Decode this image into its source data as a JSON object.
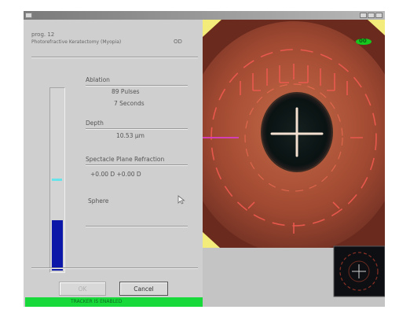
{
  "window": {
    "title": "",
    "status_text": "TRACKER IS ENABLED",
    "green_indicator": "00"
  },
  "dialog": {
    "program_line": "prog. 12",
    "mode_line": "Photorefractive Keratectomy (Myopia)",
    "eye_label": "OD",
    "ablation": {
      "label": "Ablation",
      "pulses": "89 Pulses",
      "seconds": "7 Seconds"
    },
    "depth": {
      "label": "Depth",
      "value": "10.53 µm"
    },
    "refraction": {
      "label": "Spectacle Plane Refraction",
      "value": "+0.00 D  +0.00 D"
    },
    "sphere": {
      "label": "Sphere"
    },
    "gauge": {
      "level": 0.28,
      "marker": 0.5
    },
    "buttons": {
      "ok": "OK",
      "cancel": "Cancel"
    }
  },
  "colors": {
    "window_bg": "#c9c9c9",
    "gauge_fill": "#0c19a8",
    "gauge_marker": "#69e3ea",
    "status_bar": "#18d93a",
    "eye_iris": "#b4563a",
    "eye_pupil": "#0d1414",
    "crosshair": "#f3e0d0",
    "reticle": "#f05a50",
    "corner_yellow": "#f4ec7a"
  },
  "icons": [
    "mouse-pointer-icon",
    "crosshair-icon"
  ]
}
